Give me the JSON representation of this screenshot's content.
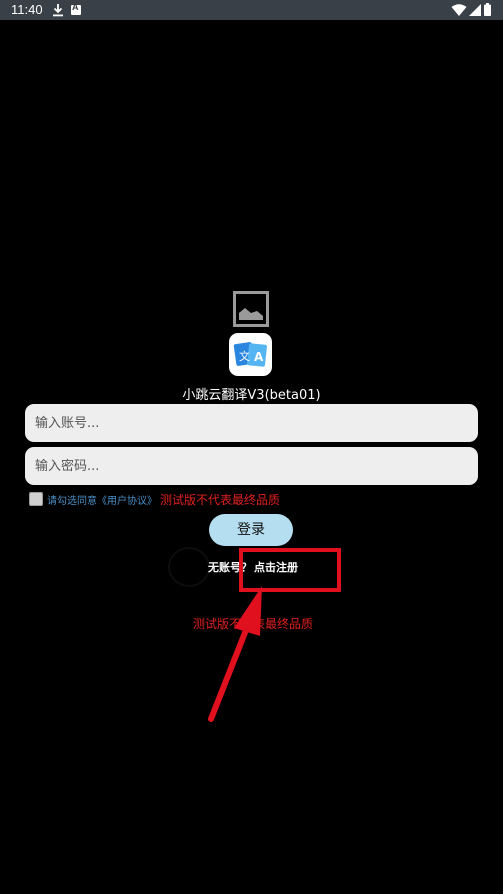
{
  "status_bar": {
    "time": "11:40",
    "icons": [
      "download-icon",
      "font-a-icon",
      "wifi-icon",
      "signal-icon",
      "battery-icon"
    ]
  },
  "app": {
    "title": "小跳云翻译V3(beta01)",
    "icon_letters": {
      "left": "文",
      "right": "A"
    }
  },
  "login_form": {
    "account_placeholder": "输入账号...",
    "password_placeholder": "输入密码...",
    "agree_text": "请勾选同意《用户协议》",
    "test_note": "测试版不代表最终品质",
    "login_label": "登录",
    "no_account_text": "无账号？",
    "register_label": "点击注册"
  },
  "footer": {
    "test_note": "测试版不代表最终品质"
  },
  "colors": {
    "background": "#000000",
    "status_bar": "#3a4048",
    "input_bg": "#eeeeee",
    "login_button": "#b5def0",
    "warning_red": "#e02020",
    "link_blue": "#4a90c8",
    "annotation_red": "#e0101e"
  }
}
